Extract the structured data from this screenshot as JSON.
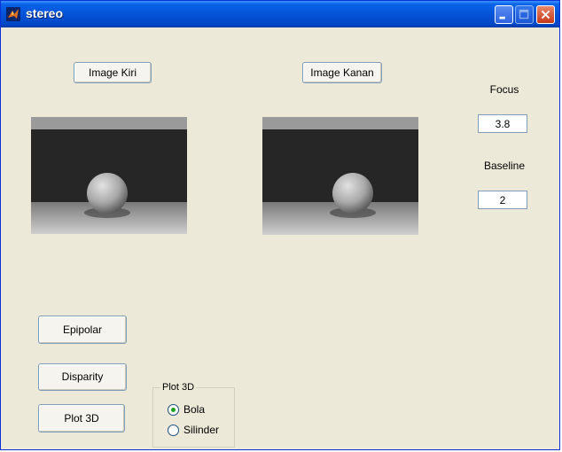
{
  "window": {
    "title": "stereo"
  },
  "buttons": {
    "image_kiri": "Image Kiri",
    "image_kanan": "Image Kanan",
    "epipolar": "Epipolar",
    "disparity": "Disparity",
    "plot3d": "Plot 3D"
  },
  "focus": {
    "label": "Focus",
    "value": "3.8"
  },
  "baseline": {
    "label": "Baseline",
    "value": "2"
  },
  "plot_group": {
    "legend": "Plot 3D",
    "options": [
      {
        "label": "Bola",
        "selected": true
      },
      {
        "label": "Silinder",
        "selected": false
      }
    ]
  },
  "colors": {
    "title_bar": "#0553d8",
    "background": "#ece9d8",
    "radio_selected": "#21a121"
  }
}
